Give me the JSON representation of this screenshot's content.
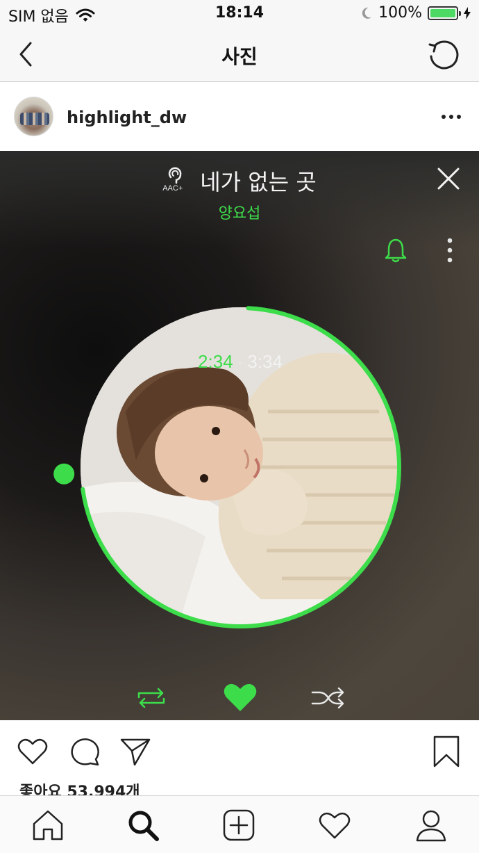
{
  "status_bar": {
    "carrier": "SIM 없음",
    "time": "18:14",
    "battery": "100%",
    "battery_level": 1.0
  },
  "navbar": {
    "title": "사진"
  },
  "post": {
    "username": "highlight_dw"
  },
  "player": {
    "song_title": "네가 없는 곳",
    "badge": "AAC+",
    "artist": "양요섭",
    "current_time": "2:34",
    "separator": "·",
    "total_time": "3:34",
    "progress_fraction": 0.72,
    "accent_color": "#3ddc4a"
  },
  "actions": {
    "likes_text": "좋아요 53,994개"
  },
  "icons": {
    "nav": [
      "back-icon",
      "refresh-icon"
    ],
    "post": [
      "more-icon"
    ],
    "player": [
      "aac-icon",
      "close-icon",
      "bell-icon",
      "vertical-more-icon",
      "repeat-icon",
      "heart-icon",
      "shuffle-icon"
    ],
    "actions": [
      "like-icon",
      "comment-icon",
      "share-icon",
      "bookmark-icon"
    ],
    "tabs": [
      "home-icon",
      "search-icon",
      "add-icon",
      "activity-icon",
      "profile-icon"
    ]
  }
}
